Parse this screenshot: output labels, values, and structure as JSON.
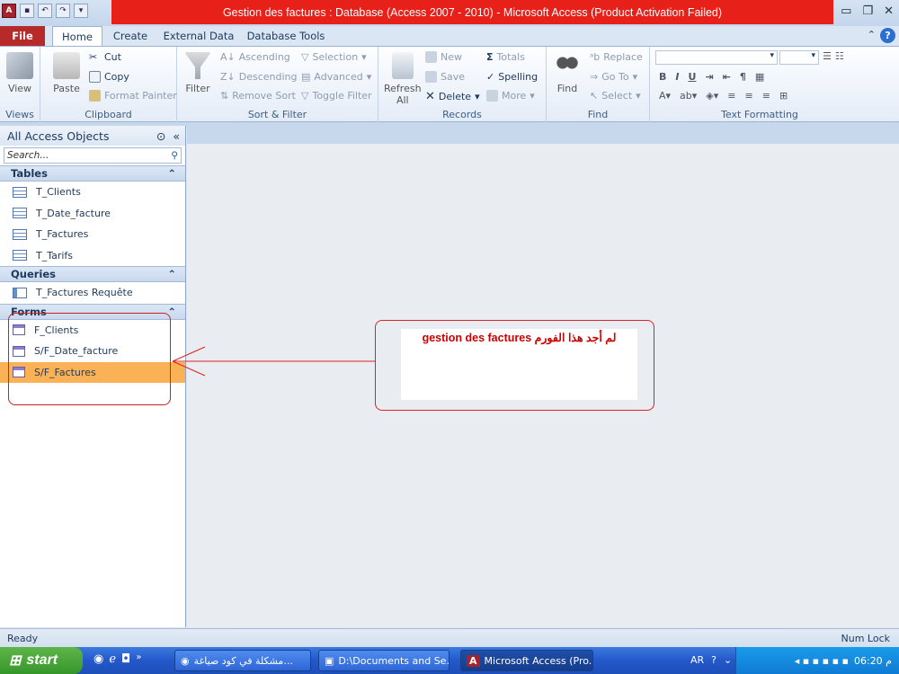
{
  "window": {
    "title": "Gestion des factures : Database (Access 2007 - 2010)  -  Microsoft Access (Product Activation Failed)"
  },
  "tabs": [
    "File",
    "Home",
    "Create",
    "External Data",
    "Database Tools"
  ],
  "ribbon": {
    "views": {
      "view": "View",
      "label": "Views"
    },
    "clipboard": {
      "paste": "Paste",
      "cut": "Cut",
      "copy": "Copy",
      "format_painter": "Format Painter",
      "label": "Clipboard"
    },
    "sort_filter": {
      "filter": "Filter",
      "ascending": "Ascending",
      "descending": "Descending",
      "remove_sort": "Remove Sort",
      "selection": "Selection",
      "advanced": "Advanced",
      "toggle_filter": "Toggle Filter",
      "label": "Sort & Filter"
    },
    "records": {
      "refresh": "Refresh",
      "refresh_sub": "All",
      "new": "New",
      "save": "Save",
      "delete": "Delete",
      "totals": "Totals",
      "spelling": "Spelling",
      "more": "More",
      "label": "Records"
    },
    "find": {
      "find": "Find",
      "replace": "Replace",
      "goto": "Go To",
      "select": "Select",
      "label": "Find"
    },
    "text_formatting": {
      "label": "Text Formatting"
    }
  },
  "nav": {
    "title": "All Access Objects",
    "search_placeholder": "Search...",
    "sections": [
      {
        "name": "Tables",
        "items": [
          "T_Clients",
          "T_Date_facture",
          "T_Factures",
          "T_Tarifs"
        ]
      },
      {
        "name": "Queries",
        "items": [
          "T_Factures Requête"
        ]
      },
      {
        "name": "Forms",
        "items": [
          "F_Clients",
          "S/F_Date_facture",
          "S/F_Factures"
        ]
      }
    ]
  },
  "annotation": {
    "text": "لم أجد هذا الفورم gestion des factures"
  },
  "status": {
    "left": "Ready",
    "right": "Num Lock"
  },
  "taskbar": {
    "start": "start",
    "buttons": [
      "مشكلة في كود صياغة...",
      "D:\\Documents and Se...",
      "Microsoft Access (Pro..."
    ],
    "lang": "AR",
    "clock": "م 06:20"
  }
}
